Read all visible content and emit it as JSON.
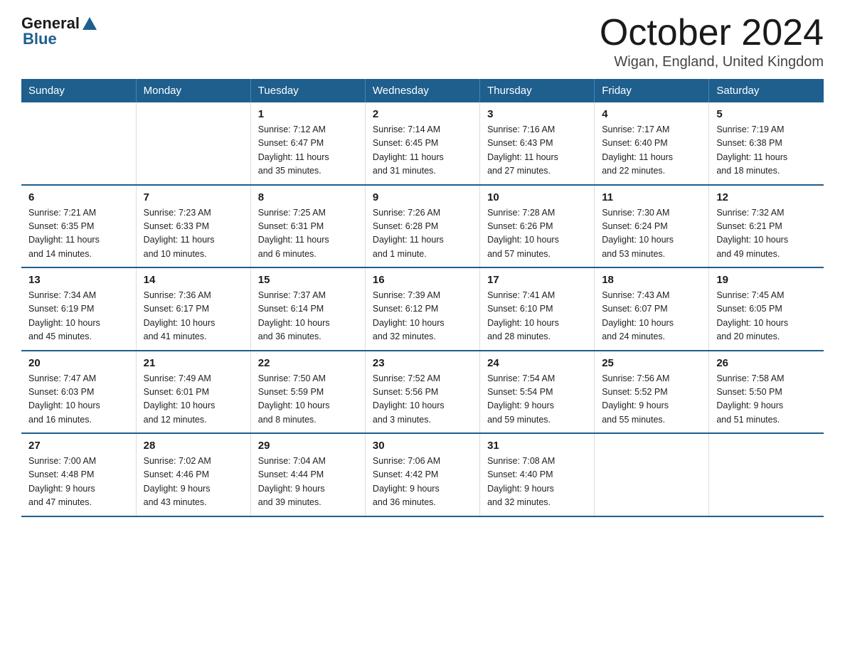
{
  "logo": {
    "general": "General",
    "blue": "Blue"
  },
  "title": "October 2024",
  "location": "Wigan, England, United Kingdom",
  "days_of_week": [
    "Sunday",
    "Monday",
    "Tuesday",
    "Wednesday",
    "Thursday",
    "Friday",
    "Saturday"
  ],
  "weeks": [
    [
      {
        "day": "",
        "info": ""
      },
      {
        "day": "",
        "info": ""
      },
      {
        "day": "1",
        "info": "Sunrise: 7:12 AM\nSunset: 6:47 PM\nDaylight: 11 hours\nand 35 minutes."
      },
      {
        "day": "2",
        "info": "Sunrise: 7:14 AM\nSunset: 6:45 PM\nDaylight: 11 hours\nand 31 minutes."
      },
      {
        "day": "3",
        "info": "Sunrise: 7:16 AM\nSunset: 6:43 PM\nDaylight: 11 hours\nand 27 minutes."
      },
      {
        "day": "4",
        "info": "Sunrise: 7:17 AM\nSunset: 6:40 PM\nDaylight: 11 hours\nand 22 minutes."
      },
      {
        "day": "5",
        "info": "Sunrise: 7:19 AM\nSunset: 6:38 PM\nDaylight: 11 hours\nand 18 minutes."
      }
    ],
    [
      {
        "day": "6",
        "info": "Sunrise: 7:21 AM\nSunset: 6:35 PM\nDaylight: 11 hours\nand 14 minutes."
      },
      {
        "day": "7",
        "info": "Sunrise: 7:23 AM\nSunset: 6:33 PM\nDaylight: 11 hours\nand 10 minutes."
      },
      {
        "day": "8",
        "info": "Sunrise: 7:25 AM\nSunset: 6:31 PM\nDaylight: 11 hours\nand 6 minutes."
      },
      {
        "day": "9",
        "info": "Sunrise: 7:26 AM\nSunset: 6:28 PM\nDaylight: 11 hours\nand 1 minute."
      },
      {
        "day": "10",
        "info": "Sunrise: 7:28 AM\nSunset: 6:26 PM\nDaylight: 10 hours\nand 57 minutes."
      },
      {
        "day": "11",
        "info": "Sunrise: 7:30 AM\nSunset: 6:24 PM\nDaylight: 10 hours\nand 53 minutes."
      },
      {
        "day": "12",
        "info": "Sunrise: 7:32 AM\nSunset: 6:21 PM\nDaylight: 10 hours\nand 49 minutes."
      }
    ],
    [
      {
        "day": "13",
        "info": "Sunrise: 7:34 AM\nSunset: 6:19 PM\nDaylight: 10 hours\nand 45 minutes."
      },
      {
        "day": "14",
        "info": "Sunrise: 7:36 AM\nSunset: 6:17 PM\nDaylight: 10 hours\nand 41 minutes."
      },
      {
        "day": "15",
        "info": "Sunrise: 7:37 AM\nSunset: 6:14 PM\nDaylight: 10 hours\nand 36 minutes."
      },
      {
        "day": "16",
        "info": "Sunrise: 7:39 AM\nSunset: 6:12 PM\nDaylight: 10 hours\nand 32 minutes."
      },
      {
        "day": "17",
        "info": "Sunrise: 7:41 AM\nSunset: 6:10 PM\nDaylight: 10 hours\nand 28 minutes."
      },
      {
        "day": "18",
        "info": "Sunrise: 7:43 AM\nSunset: 6:07 PM\nDaylight: 10 hours\nand 24 minutes."
      },
      {
        "day": "19",
        "info": "Sunrise: 7:45 AM\nSunset: 6:05 PM\nDaylight: 10 hours\nand 20 minutes."
      }
    ],
    [
      {
        "day": "20",
        "info": "Sunrise: 7:47 AM\nSunset: 6:03 PM\nDaylight: 10 hours\nand 16 minutes."
      },
      {
        "day": "21",
        "info": "Sunrise: 7:49 AM\nSunset: 6:01 PM\nDaylight: 10 hours\nand 12 minutes."
      },
      {
        "day": "22",
        "info": "Sunrise: 7:50 AM\nSunset: 5:59 PM\nDaylight: 10 hours\nand 8 minutes."
      },
      {
        "day": "23",
        "info": "Sunrise: 7:52 AM\nSunset: 5:56 PM\nDaylight: 10 hours\nand 3 minutes."
      },
      {
        "day": "24",
        "info": "Sunrise: 7:54 AM\nSunset: 5:54 PM\nDaylight: 9 hours\nand 59 minutes."
      },
      {
        "day": "25",
        "info": "Sunrise: 7:56 AM\nSunset: 5:52 PM\nDaylight: 9 hours\nand 55 minutes."
      },
      {
        "day": "26",
        "info": "Sunrise: 7:58 AM\nSunset: 5:50 PM\nDaylight: 9 hours\nand 51 minutes."
      }
    ],
    [
      {
        "day": "27",
        "info": "Sunrise: 7:00 AM\nSunset: 4:48 PM\nDaylight: 9 hours\nand 47 minutes."
      },
      {
        "day": "28",
        "info": "Sunrise: 7:02 AM\nSunset: 4:46 PM\nDaylight: 9 hours\nand 43 minutes."
      },
      {
        "day": "29",
        "info": "Sunrise: 7:04 AM\nSunset: 4:44 PM\nDaylight: 9 hours\nand 39 minutes."
      },
      {
        "day": "30",
        "info": "Sunrise: 7:06 AM\nSunset: 4:42 PM\nDaylight: 9 hours\nand 36 minutes."
      },
      {
        "day": "31",
        "info": "Sunrise: 7:08 AM\nSunset: 4:40 PM\nDaylight: 9 hours\nand 32 minutes."
      },
      {
        "day": "",
        "info": ""
      },
      {
        "day": "",
        "info": ""
      }
    ]
  ]
}
